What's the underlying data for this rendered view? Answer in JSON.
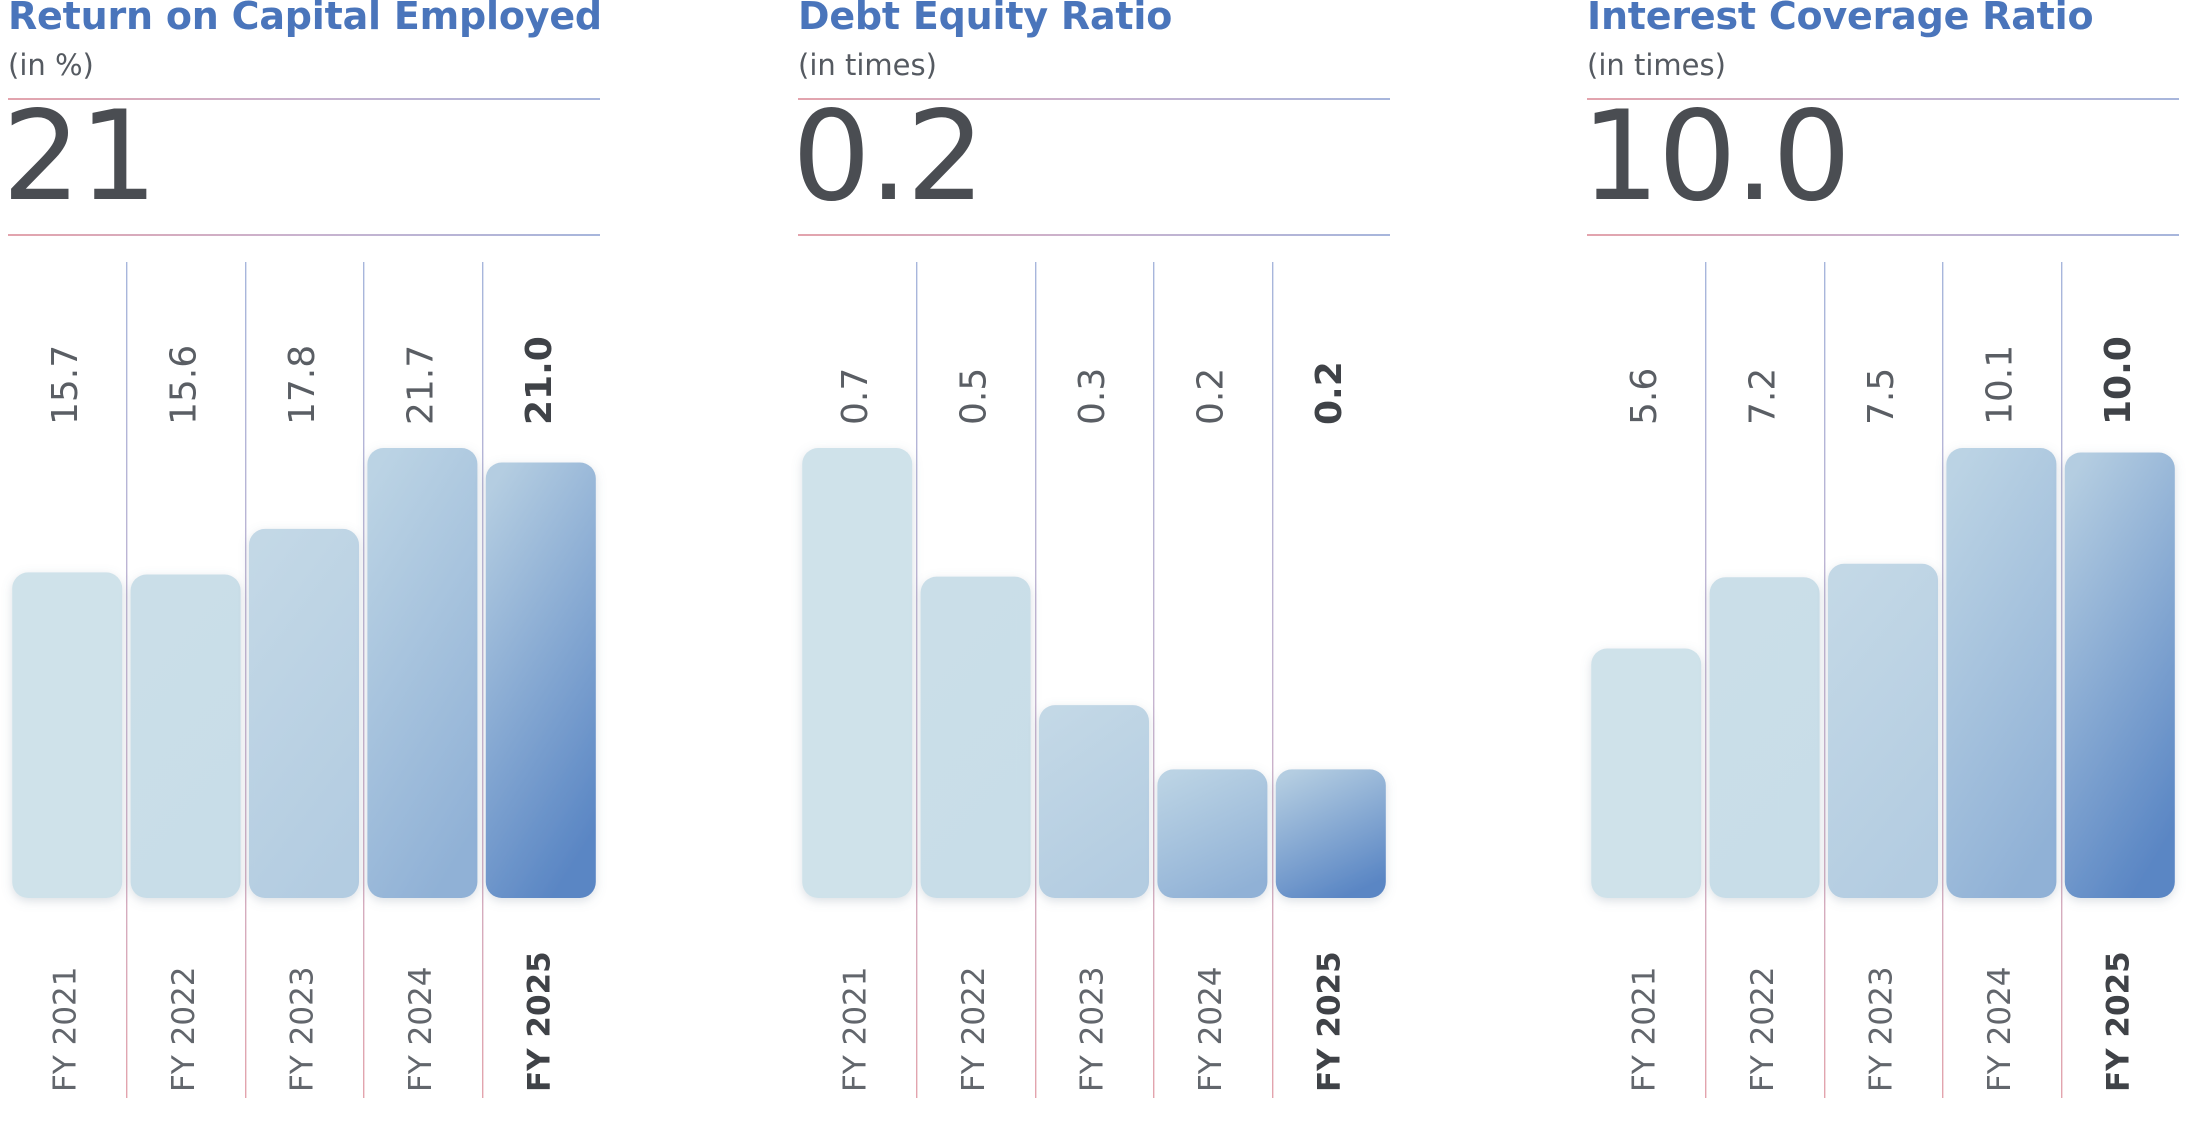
{
  "chart_data": [
    {
      "type": "bar",
      "title": "Return on Capital Employed",
      "subtitle": "(in %)",
      "headline": "21",
      "categories": [
        "FY 2021",
        "FY 2022",
        "FY 2023",
        "FY 2024",
        "FY 2025"
      ],
      "values": [
        15.7,
        15.6,
        17.8,
        21.7,
        21.0
      ],
      "value_labels": [
        "15.7",
        "15.6",
        "17.8",
        "21.7",
        "21.0"
      ],
      "highlight_index": 4,
      "ylim": [
        0,
        21.7
      ]
    },
    {
      "type": "bar",
      "title": "Debt Equity Ratio",
      "subtitle": "(in times)",
      "headline": "0.2",
      "categories": [
        "FY 2021",
        "FY 2022",
        "FY 2023",
        "FY 2024",
        "FY 2025"
      ],
      "values": [
        0.7,
        0.5,
        0.3,
        0.2,
        0.2
      ],
      "value_labels": [
        "0.7",
        "0.5",
        "0.3",
        "0.2",
        "0.2"
      ],
      "highlight_index": 4,
      "ylim": [
        0,
        0.7
      ]
    },
    {
      "type": "bar",
      "title": "Interest Coverage Ratio",
      "subtitle": "(in times)",
      "headline": "10.0",
      "categories": [
        "FY 2021",
        "FY 2022",
        "FY 2023",
        "FY 2024",
        "FY 2025"
      ],
      "values": [
        5.6,
        7.2,
        7.5,
        10.1,
        10.0
      ],
      "value_labels": [
        "5.6",
        "7.2",
        "7.5",
        "10.1",
        "10.0"
      ],
      "highlight_index": 4,
      "ylim": [
        0,
        10.1
      ]
    }
  ],
  "colors": {
    "title": "#4a75bb",
    "text": "#4a4d52",
    "bar_light": "#cfe2ea",
    "bar_dark": "#5a86c4",
    "divider_blue": "#a7b6dc",
    "divider_red": "#e3a4ad"
  }
}
